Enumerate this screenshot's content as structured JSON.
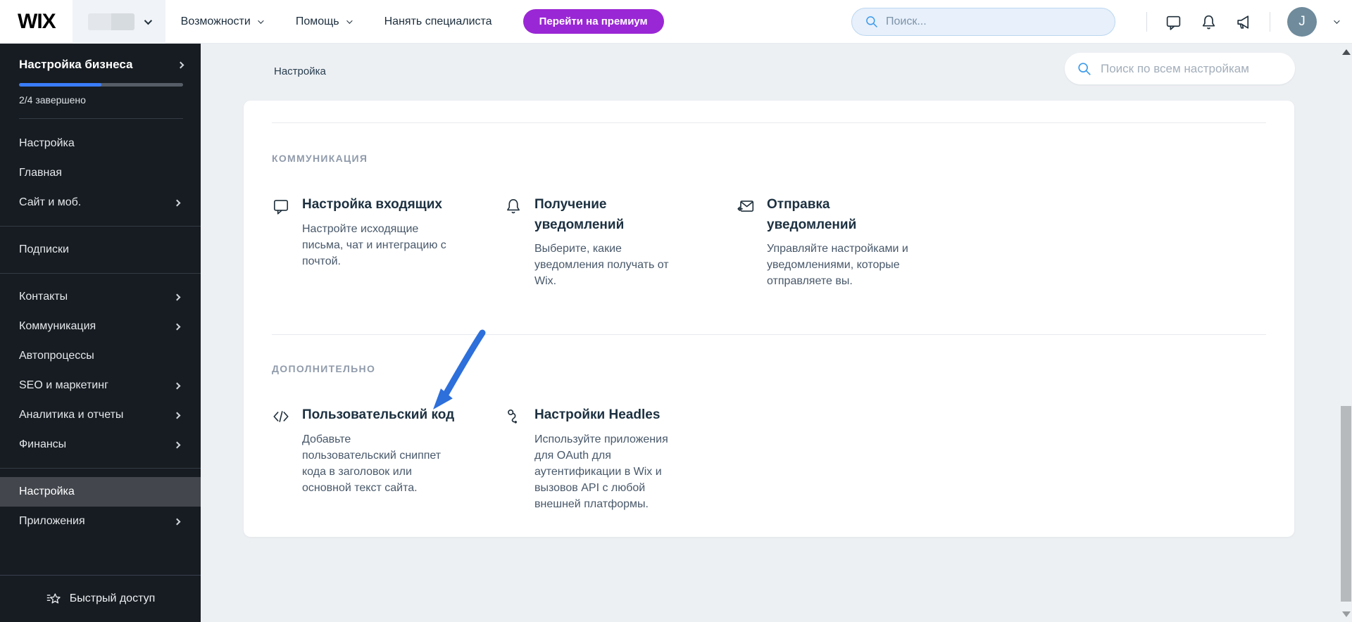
{
  "topbar": {
    "logo": "WIX",
    "nav": [
      {
        "label": "Возможности",
        "chevron": true
      },
      {
        "label": "Помощь",
        "chevron": true
      },
      {
        "label": "Нанять специалиста",
        "chevron": false
      }
    ],
    "premium_button": "Перейти на премиум",
    "search_placeholder": "Поиск...",
    "avatar_initial": "J",
    "icons": [
      "chat-icon",
      "bell-icon",
      "megaphone-icon",
      "search-icon",
      "chevron-down-icon"
    ]
  },
  "sidebar": {
    "header": {
      "title": "Настройка бизнеса",
      "progress_percent": 50,
      "progress_label": "2/4 завершено"
    },
    "items": [
      {
        "label": "Настройка",
        "chevron": false,
        "selected": false
      },
      {
        "label": "Главная",
        "chevron": false,
        "selected": false
      },
      {
        "label": "Сайт и моб.",
        "chevron": true,
        "selected": false
      },
      {
        "label": "Подписки",
        "chevron": false,
        "selected": false
      },
      {
        "label": "Контакты",
        "chevron": true,
        "selected": false
      },
      {
        "label": "Коммуникация",
        "chevron": true,
        "selected": false
      },
      {
        "label": "Автопроцессы",
        "chevron": false,
        "selected": false
      },
      {
        "label": "SEO и маркетинг",
        "chevron": true,
        "selected": false
      },
      {
        "label": "Аналитика и отчеты",
        "chevron": true,
        "selected": false
      },
      {
        "label": "Финансы",
        "chevron": true,
        "selected": false
      },
      {
        "label": "Настройка",
        "chevron": false,
        "selected": true
      },
      {
        "label": "Приложения",
        "chevron": true,
        "selected": false
      }
    ],
    "quick_access": "Быстрый доступ"
  },
  "main": {
    "breadcrumb": "Настройка",
    "settings_search_placeholder": "Поиск по всем настройкам",
    "sections": [
      {
        "label": "КОММУНИКАЦИЯ",
        "items": [
          {
            "icon": "chat-icon",
            "title": "Настройка входящих",
            "desc": "Настройте исходящие письма, чат и интеграцию с почтой."
          },
          {
            "icon": "bell-icon",
            "title": "Получение уведомлений",
            "desc": "Выберите, какие уведомления получать от Wix."
          },
          {
            "icon": "send-email-icon",
            "title": "Отправка уведомлений",
            "desc": "Управляйте настройками и уведомлениями, которые отправляете вы."
          }
        ]
      },
      {
        "label": "ДОПОЛНИТЕЛЬНО",
        "items": [
          {
            "icon": "code-icon",
            "title": "Пользовательский код",
            "desc": "Добавьте пользовательский сниппет кода в заголовок или основной текст сайта."
          },
          {
            "icon": "headless-icon",
            "title": "Настройки Headles",
            "desc": "Используйте приложения для OAuth для аутентификации в Wix и вызовов API с любой внешней платформы."
          }
        ]
      }
    ]
  },
  "colors": {
    "premium_purple": "#9a27d5",
    "progress_blue": "#3a7cfb",
    "arrow_blue": "#2d6fdb",
    "search_icon_blue": "#3d9be9",
    "sidebar_bg": "#171c22",
    "avatar_bg": "#6f8b9c"
  }
}
